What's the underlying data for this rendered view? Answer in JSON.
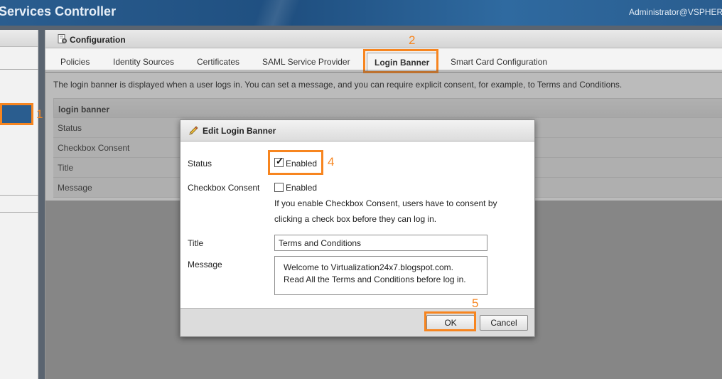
{
  "header": {
    "app_title": "Services Controller",
    "user": "Administrator@VSPHER"
  },
  "panel": {
    "title": "Configuration",
    "tabs": [
      {
        "label": "Policies"
      },
      {
        "label": "Identity Sources"
      },
      {
        "label": "Certificates"
      },
      {
        "label": "SAML Service Provider"
      },
      {
        "label": "Login Banner",
        "active": true
      },
      {
        "label": "Smart Card Configuration"
      }
    ],
    "description": "The login banner is displayed when a user logs in. You can set a message, and you can require explicit consent, for example, to Terms and Conditions.",
    "table": {
      "header": "login banner",
      "rows": [
        "Status",
        "Checkbox Consent",
        "Title",
        "Message"
      ]
    }
  },
  "dialog": {
    "title": "Edit Login Banner",
    "status_label": "Status",
    "status_value": "Enabled",
    "status_checked": true,
    "consent_label": "Checkbox Consent",
    "consent_value": "Enabled",
    "consent_checked": false,
    "consent_help_line1": "If you enable Checkbox Consent, users have to consent by",
    "consent_help_line2": "clicking a check box before they can log in.",
    "title_label": "Title",
    "title_value": "Terms and Conditions",
    "message_label": "Message",
    "message_line1": "Welcome to Virtualization24x7.blogspot.com.",
    "message_line2": "Read All the Terms and Conditions before log in.",
    "ok_label": "OK",
    "cancel_label": "Cancel"
  },
  "callouts": {
    "one": "1",
    "two": "2",
    "four": "4",
    "five": "5"
  },
  "colors": {
    "callout": "#f7851f",
    "header_blue": "#2a5d8f"
  },
  "icons": {
    "configuration": "gear-doc-icon",
    "edit": "pencil-icon",
    "check": "checkmark-icon"
  }
}
